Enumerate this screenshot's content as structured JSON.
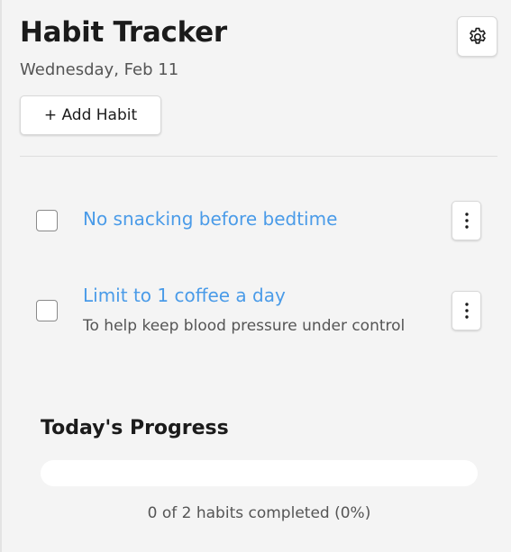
{
  "header": {
    "title": "Habit Tracker",
    "date": "Wednesday, Feb 11",
    "add_label": "+ Add Habit",
    "settings_icon": "gear-icon"
  },
  "habits": [
    {
      "name": "No snacking before bedtime",
      "description": "",
      "completed": false
    },
    {
      "name": "Limit to 1 coffee a day",
      "description": "To help keep blood pressure under control",
      "completed": false
    }
  ],
  "progress": {
    "title": "Today's Progress",
    "completed": 0,
    "total": 2,
    "percent": 0,
    "summary": "0 of 2 habits completed (0%)"
  },
  "colors": {
    "accent": "#4a9be8",
    "background": "#f4f4f4"
  }
}
